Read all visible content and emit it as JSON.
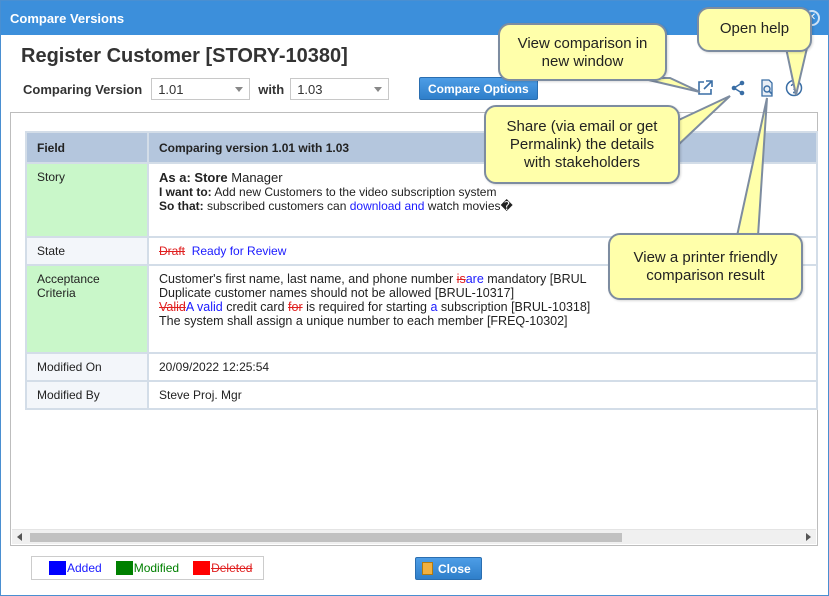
{
  "dialog": {
    "title": "Compare Versions"
  },
  "record": {
    "title": "Register Customer [STORY-10380]"
  },
  "compare": {
    "label": "Comparing Version",
    "from_version": "1.01",
    "with_label": "with",
    "to_version": "1.03",
    "options_button": "Compare Options"
  },
  "toolbar": {
    "icons": [
      "external-window-icon",
      "share-icon",
      "printer-preview-icon",
      "help-icon"
    ]
  },
  "table": {
    "headers": {
      "field": "Field",
      "value": "Comparing version 1.01 with 1.03"
    },
    "story": {
      "field": "Story",
      "as_a_label": "As a:",
      "as_a_added": "Store",
      "as_a_rest": " Manager",
      "want_label": "I want to:",
      "want_text": " Add new Customers to the video subscription system",
      "so_label": "So that:",
      "so_text_1": " subscribed customers can ",
      "so_added": "download and",
      "so_text_2": " watch movies�"
    },
    "state": {
      "field": "State",
      "deleted": "Draft",
      "added": "Ready for Review"
    },
    "acceptance": {
      "field": "Acceptance Criteria",
      "line1_a": "Customer's first name, last name, and phone number ",
      "line1_del": "is",
      "line1_add": "are",
      "line1_b": " mandatory [BRUL",
      "line2": "Duplicate customer names should not be allowed [BRUL-10317]",
      "line3_del1": "Valid",
      "line3_add1": "A valid",
      "line3_a": " credit card ",
      "line3_del2": "for",
      "line3_b": " is required for starting ",
      "line3_add2": "a",
      "line3_c": " subscription [BRUL-10318]",
      "line4": "The system shall assign a unique number to each member [FREQ-10302]"
    },
    "modified_on": {
      "field": "Modified On",
      "value": "20/09/2022 12:25:54"
    },
    "modified_by": {
      "field": "Modified By",
      "value": "Steve Proj. Mgr"
    }
  },
  "legend": {
    "added": "Added",
    "modified": "Modified",
    "deleted": "Deleted"
  },
  "colors": {
    "added": "#0000ff",
    "modified": "#008000",
    "deleted": "#ff0000",
    "accent": "#3c8fdb",
    "callout": "#ffffaa"
  },
  "close_button": "Close",
  "callouts": {
    "new_window": "View comparison in new window",
    "help": "Open help",
    "share": "Share (via email or get Permalink) the details with stakeholders",
    "print": "View a printer friendly comparison result"
  }
}
